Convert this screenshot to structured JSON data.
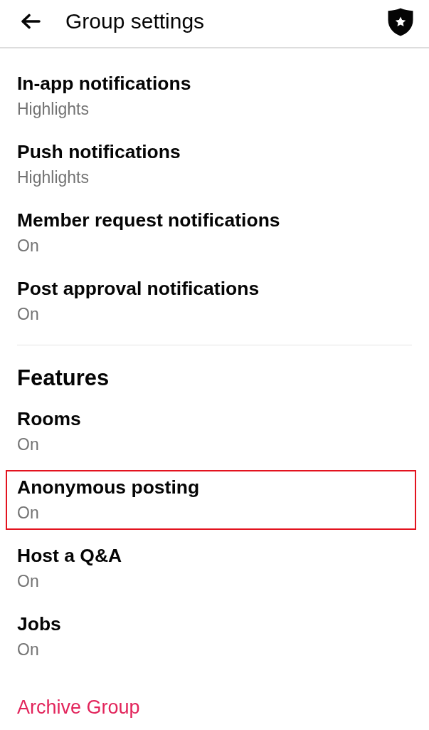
{
  "app_bar": {
    "title": "Group settings"
  },
  "sections": [
    {
      "items": [
        {
          "title": "In-app notifications",
          "value": "Highlights",
          "highlighted": false
        },
        {
          "title": "Push notifications",
          "value": "Highlights",
          "highlighted": false
        },
        {
          "title": "Member request notifications",
          "value": "On",
          "highlighted": false
        },
        {
          "title": "Post approval notifications",
          "value": "On",
          "highlighted": false
        }
      ]
    },
    {
      "title": "Features",
      "items": [
        {
          "title": "Rooms",
          "value": "On",
          "highlighted": false
        },
        {
          "title": "Anonymous posting",
          "value": "On",
          "highlighted": true
        },
        {
          "title": "Host a Q&A",
          "value": "On",
          "highlighted": false
        },
        {
          "title": "Jobs",
          "value": "On",
          "highlighted": false
        }
      ]
    }
  ],
  "actions": [
    {
      "label": "Archive Group",
      "kind": "danger"
    }
  ]
}
